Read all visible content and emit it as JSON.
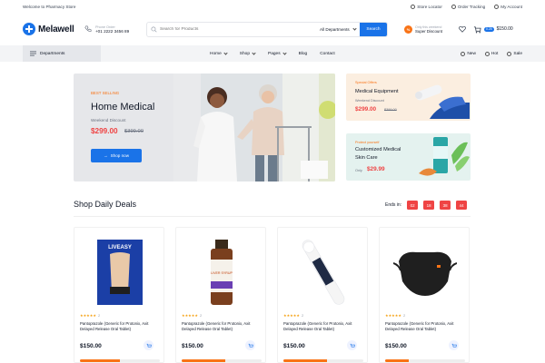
{
  "topbar": {
    "welcome": "Welcome to Pharmacy Store",
    "links": [
      "Store Locator",
      "Order Tracking",
      "My Account"
    ]
  },
  "header": {
    "logo": "Melawell",
    "phone_label": "Phone Order",
    "phone_number": "+01 2222 3456 89",
    "search_placeholder": "Search for Products",
    "department": "All Departments",
    "search_button": "Search",
    "promo_line1": "Only this weekend",
    "promo_line2": "Super Discount",
    "cart_badge": "0.25",
    "cart_amount": "$150.00"
  },
  "nav": {
    "departments": "Departments",
    "menu": [
      "Home",
      "Shop",
      "Pages",
      "Blog",
      "Contact"
    ],
    "right": [
      "New",
      "Hot",
      "Sale"
    ]
  },
  "hero": {
    "tag": "BEST SELLING",
    "title": "Home Medical",
    "subtitle": "Weekend Discount",
    "price": "$299.00",
    "old_price": "$399.00",
    "button": "Shop now"
  },
  "side1": {
    "tag": "Special Offers",
    "title": "Medical Equipment",
    "subtitle": "Weekend Discount",
    "price": "$299.00",
    "old_price": "$399.00"
  },
  "side2": {
    "tag": "Protect yourself",
    "title_line1": "Customized Medical",
    "title_line2": "Skin Care",
    "only": "Only",
    "price": "$29.99"
  },
  "deals": {
    "title": "Shop Daily Deals",
    "ends_label": "Ends in:",
    "timer": [
      "02",
      "18",
      "38",
      "44"
    ]
  },
  "products": [
    {
      "name": "Pantoprazole (Generic for Protonix, Axit Delayed Release Oral Tablet)",
      "stars": "★★★★★",
      "reviews": "2",
      "price": "$150.00",
      "sold_fraction": 0.5,
      "image_text": "LIVEASY"
    },
    {
      "name": "Pantoprazole (Generic for Protonix, Axit Delayed Release Oral Tablet)",
      "stars": "★★★★★",
      "reviews": "2",
      "price": "$150.00",
      "sold_fraction": 0.55,
      "image_text": "LIVER SYRUP"
    },
    {
      "name": "Pantoprazole (Generic for Protonix, Axit Delayed Release Oral Tablet)",
      "stars": "★★★★★",
      "reviews": "2",
      "price": "$150.00",
      "sold_fraction": 0.55
    },
    {
      "name": "Pantoprazole (Generic for Protonix, Axit Delayed Release Oral Tablet)",
      "stars": "★★★★★",
      "reviews": "2",
      "price": "$150.00",
      "sold_fraction": 0.3
    }
  ],
  "colors": {
    "brand": "#1a73e8",
    "accent": "#f97316",
    "price": "#ef4444"
  }
}
